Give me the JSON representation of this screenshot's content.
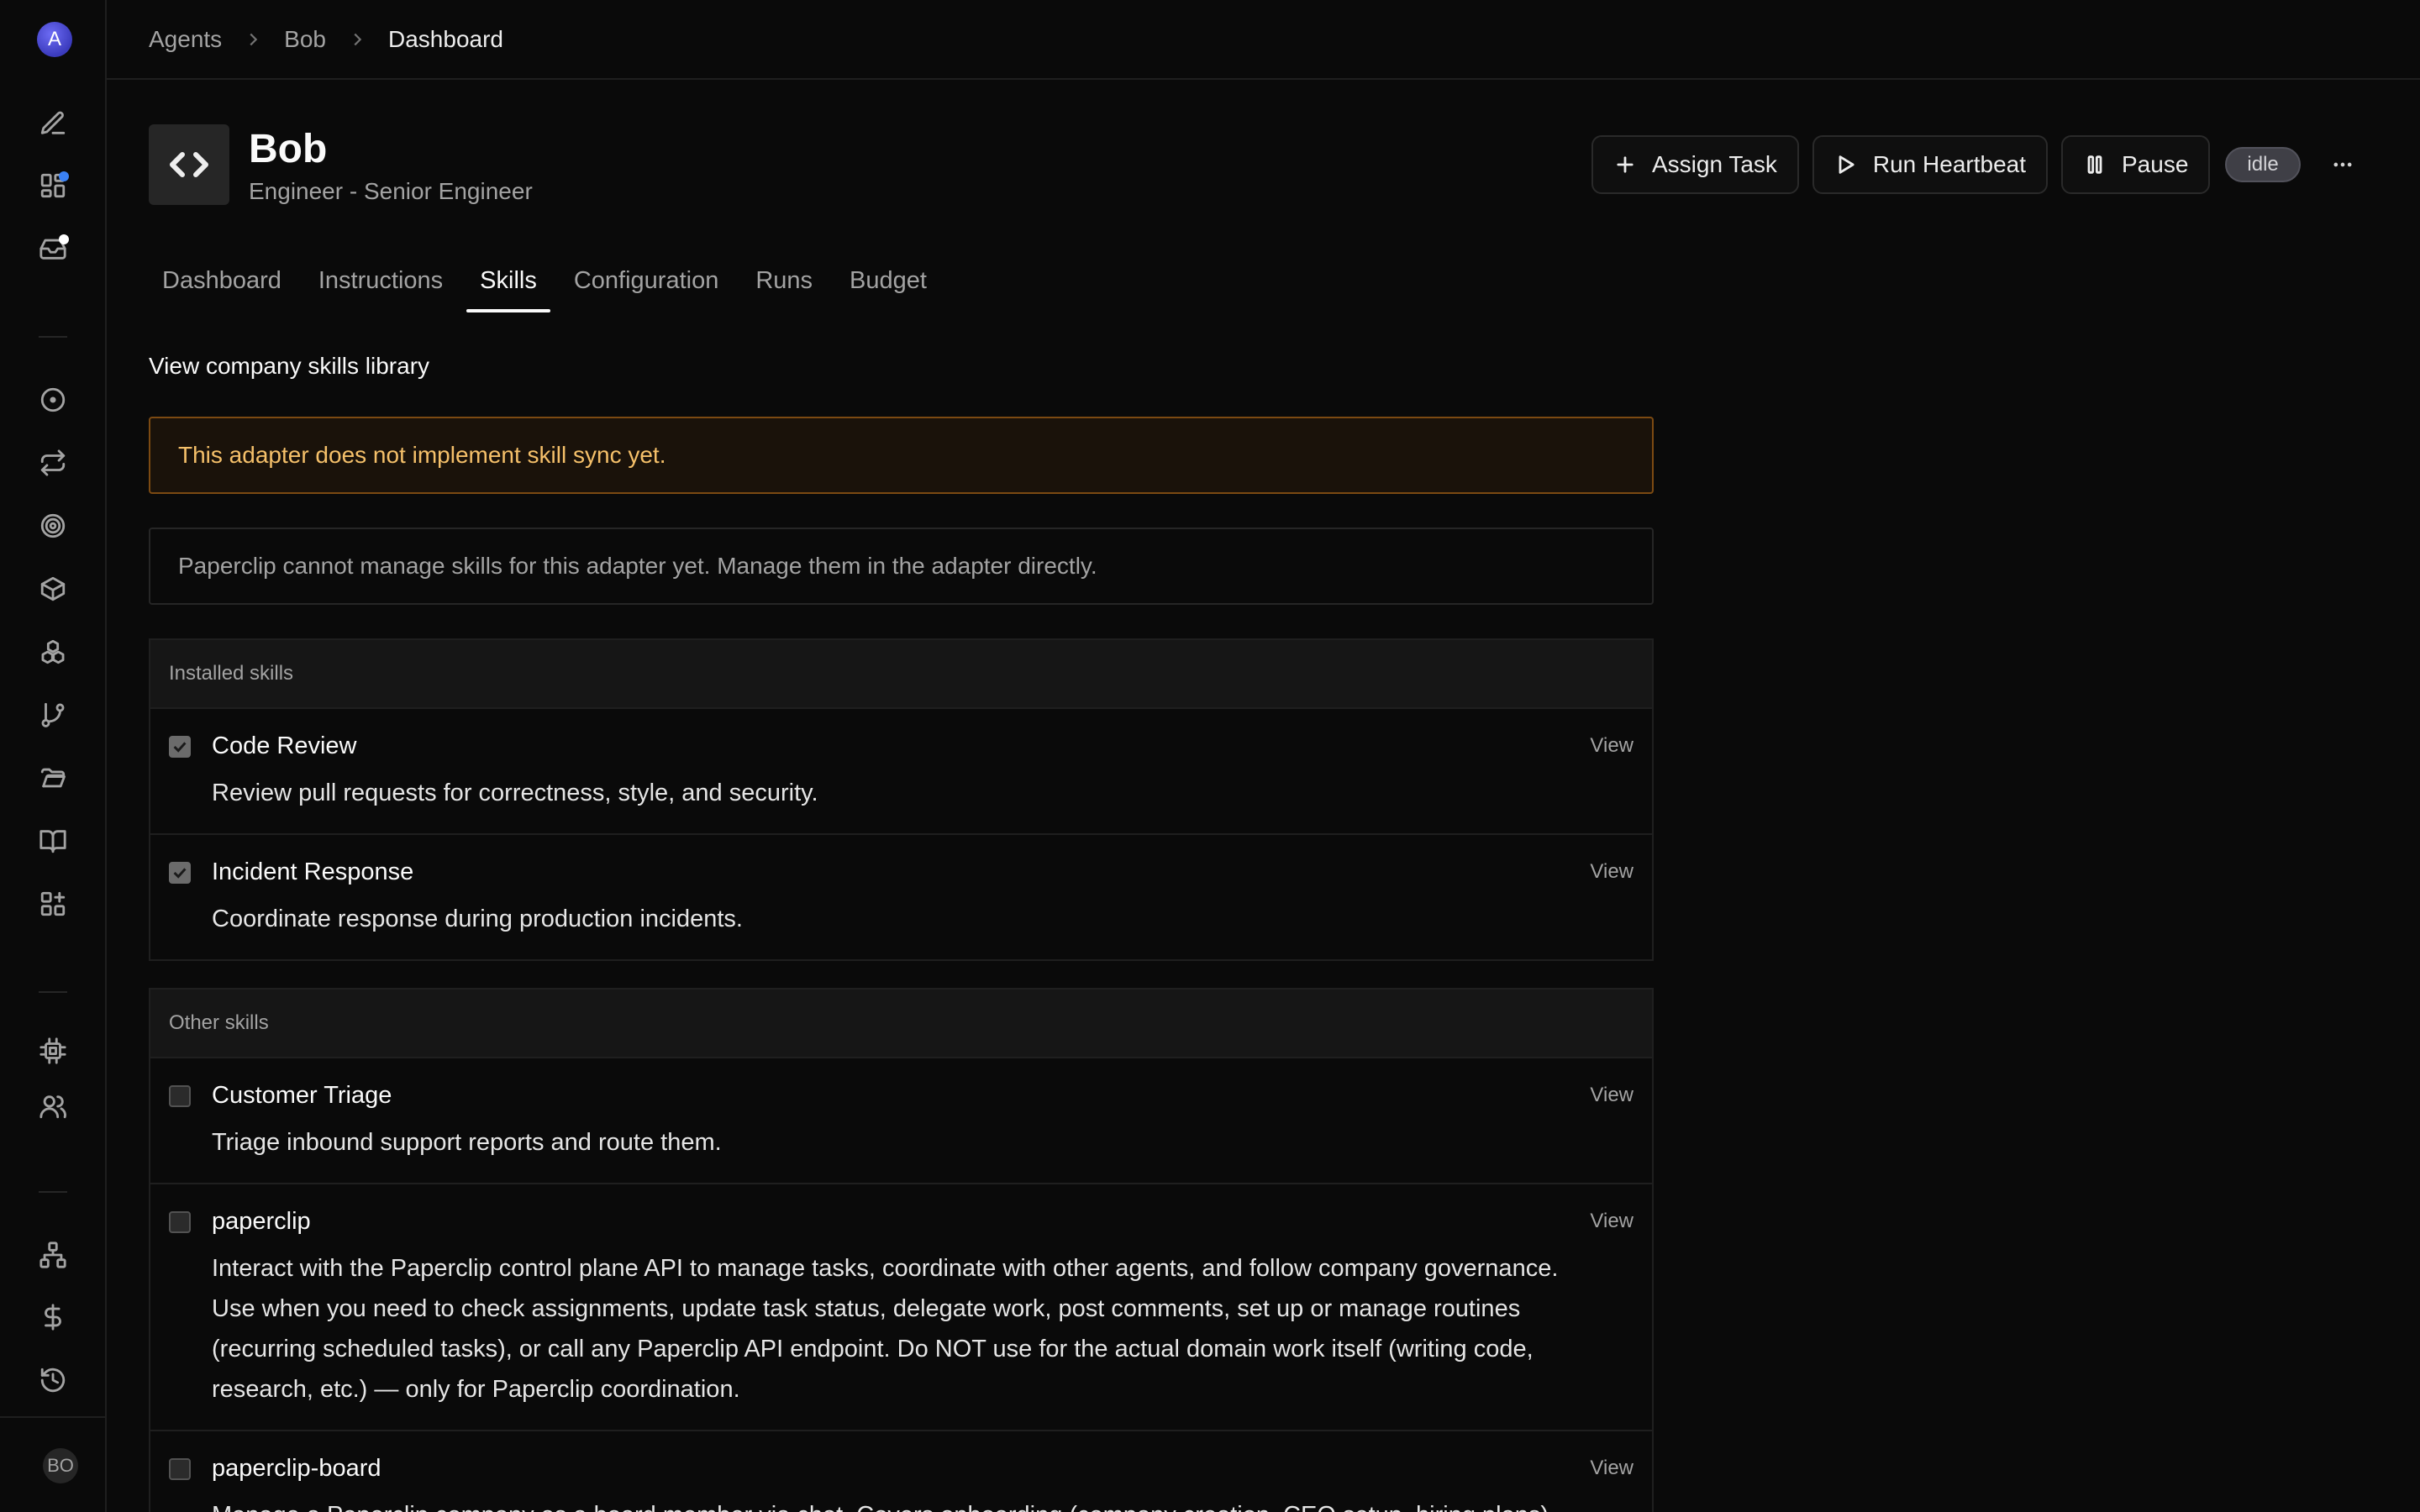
{
  "org": {
    "initial": "A"
  },
  "user": {
    "initials": "BO"
  },
  "sidebar": {
    "top_icons": [
      "new-issue-icon",
      "dashboard-icon",
      "inbox-icon"
    ],
    "main_icons": [
      "issues-icon",
      "routines-icon",
      "goals-icon",
      "projects-icon",
      "agents-icon",
      "workflows-icon",
      "files-icon",
      "docs-icon",
      "plugins-icon"
    ],
    "lower_icons": [
      "adapters-icon",
      "members-icon"
    ],
    "bottom_icons": [
      "org-chart-icon",
      "costs-icon",
      "activity-icon"
    ]
  },
  "breadcrumb": {
    "items": [
      "Agents",
      "Bob",
      "Dashboard"
    ]
  },
  "agent": {
    "name": "Bob",
    "role": "Engineer - Senior Engineer"
  },
  "actions": {
    "assign_task": "Assign Task",
    "run_heartbeat": "Run Heartbeat",
    "pause": "Pause",
    "status": "idle"
  },
  "tabs": [
    "Dashboard",
    "Instructions",
    "Skills",
    "Configuration",
    "Runs",
    "Budget"
  ],
  "active_tab": "Skills",
  "library_link": "View company skills library",
  "alerts": {
    "warning": "This adapter does not implement skill sync yet.",
    "info": "Paperclip cannot manage skills for this adapter yet. Manage them in the adapter directly."
  },
  "installed": {
    "title": "Installed skills",
    "items": [
      {
        "name": "Code Review",
        "desc": "Review pull requests for correctness, style, and security.",
        "view": "View",
        "checked": true
      },
      {
        "name": "Incident Response",
        "desc": "Coordinate response during production incidents.",
        "view": "View",
        "checked": true
      }
    ]
  },
  "other": {
    "title": "Other skills",
    "items": [
      {
        "name": "Customer Triage",
        "desc": "Triage inbound support reports and route them.",
        "view": "View",
        "checked": false
      },
      {
        "name": "paperclip",
        "desc": "Interact with the Paperclip control plane API to manage tasks, coordinate with other agents, and follow company governance. Use when you need to check assignments, update task status, delegate work, post comments, set up or manage routines (recurring scheduled tasks), or call any Paperclip API endpoint. Do NOT use for the actual domain work itself (writing code, research, etc.) — only for Paperclip coordination.",
        "view": "View",
        "checked": false
      },
      {
        "name": "paperclip-board",
        "desc": "Manage a Paperclip company as a board member via chat. Covers onboarding (company creation, CEO setup, hiring plans),",
        "view": "View",
        "checked": false
      }
    ]
  }
}
